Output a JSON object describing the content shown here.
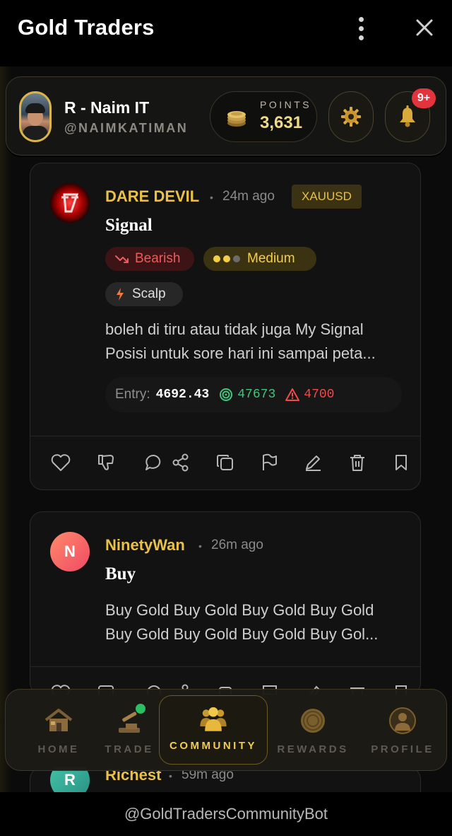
{
  "window": {
    "title": "Gold Traders"
  },
  "user": {
    "name": "R - Naim IT",
    "handle": "@NAIMKATIMAN"
  },
  "points": {
    "label": "POINTS",
    "value": "3,631"
  },
  "notifications": {
    "badge": "9+"
  },
  "posts": [
    {
      "author": "DARE DEVIL",
      "time": "24m ago",
      "symbol": "XAUUSD",
      "title": "Signal",
      "tags": {
        "direction": "Bearish",
        "strength": "Medium",
        "style": "Scalp"
      },
      "body_lines": [
        "boleh di tiru atau tidak juga My Signal",
        "Posisi untuk sore hari ini sampai peta..."
      ],
      "entry": {
        "label": "Entry:",
        "value": "4692.43",
        "tp": "47673",
        "sl": "4700"
      }
    },
    {
      "author": "NinetyWan",
      "avatar_letter": "N",
      "time": "26m ago",
      "title": "Buy",
      "body_lines": [
        "Buy Gold Buy Gold Buy Gold Buy Gold",
        "Buy Gold Buy Gold Buy Gold Buy Gol..."
      ]
    },
    {
      "author": "Richest",
      "avatar_letter": "R",
      "time": "59m ago"
    }
  ],
  "nav": {
    "home": "HOME",
    "trade": "TRADE",
    "community": "COMMUNITY",
    "rewards": "REWARDS",
    "profile": "PROFILE",
    "active": "community"
  },
  "footer": {
    "text": "@GoldTradersCommunityBot"
  },
  "colors": {
    "gold": "#e8c04a",
    "bearish": "#f05a5a",
    "take_profit": "#44c47a",
    "stop_loss": "#f04a4a",
    "badge": "#e3343d"
  }
}
